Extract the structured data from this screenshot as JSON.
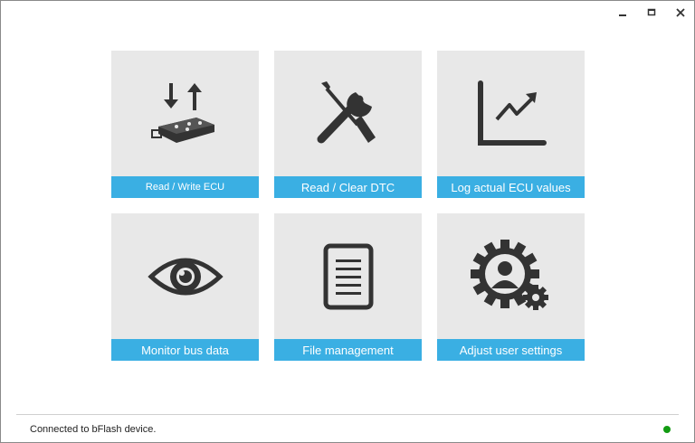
{
  "window": {
    "controls": [
      "minimize",
      "maximize",
      "close"
    ]
  },
  "tiles": [
    {
      "label": "Read / Write ECU",
      "icon": "read-write-ecu-icon"
    },
    {
      "label": "Read / Clear DTC",
      "icon": "tools-icon"
    },
    {
      "label": "Log actual ECU values",
      "icon": "line-chart-icon"
    },
    {
      "label": "Monitor bus data",
      "icon": "eye-icon"
    },
    {
      "label": "File management",
      "icon": "document-icon"
    },
    {
      "label": "Adjust user settings",
      "icon": "user-settings-gear-icon"
    }
  ],
  "status": {
    "text": "Connected to bFlash device.",
    "indicator_color": "#129b12"
  },
  "colors": {
    "tile_bg": "#e8e8e8",
    "label_bg": "#3aafe3",
    "icon": "#333333"
  }
}
